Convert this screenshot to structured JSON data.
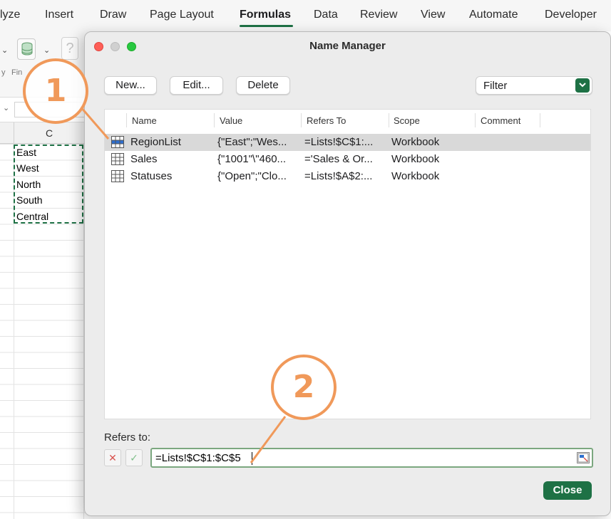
{
  "ribbon": {
    "tabs": [
      {
        "label": "lyze",
        "active": false
      },
      {
        "label": "Insert",
        "active": false
      },
      {
        "label": "Draw",
        "active": false
      },
      {
        "label": "Page Layout",
        "active": false
      },
      {
        "label": "Formulas",
        "active": true
      },
      {
        "label": "Data",
        "active": false
      },
      {
        "label": "Review",
        "active": false
      },
      {
        "label": "View",
        "active": false
      },
      {
        "label": "Automate",
        "active": false
      },
      {
        "label": "Developer",
        "active": false
      }
    ],
    "accent_color": "#1e7145"
  },
  "toolbar": {
    "labels": [
      "y",
      "Fin"
    ],
    "icons": [
      "chevron-down-icon",
      "database-icon",
      "help-icon"
    ]
  },
  "sheet": {
    "column_header": "C",
    "cells": [
      "East",
      "West",
      "North",
      "South",
      "Central"
    ]
  },
  "dialog": {
    "title": "Name Manager",
    "buttons": {
      "new": "New...",
      "edit": "Edit...",
      "delete": "Delete"
    },
    "filter": {
      "label": "Filter"
    },
    "columns": [
      "Name",
      "Value",
      "Refers To",
      "Scope",
      "Comment"
    ],
    "rows": [
      {
        "name": "RegionList",
        "value": "{\"East\";\"Wes...",
        "refers_to": "=Lists!$C$1:...",
        "scope": "Workbook",
        "comment": "",
        "selected": true
      },
      {
        "name": "Sales",
        "value": "{\"1001\"\\\"460...",
        "refers_to": "='Sales & Or...",
        "scope": "Workbook",
        "comment": "",
        "selected": false
      },
      {
        "name": "Statuses",
        "value": "{\"Open\";\"Clo...",
        "refers_to": "=Lists!$A$2:...",
        "scope": "Workbook",
        "comment": "",
        "selected": false
      }
    ],
    "refers_to_label": "Refers to:",
    "refers_to_value": "=Lists!$C$1:$C$5",
    "close_label": "Close"
  },
  "callouts": [
    {
      "label": "1"
    },
    {
      "label": "2"
    }
  ],
  "callout_color": "#f0995a"
}
